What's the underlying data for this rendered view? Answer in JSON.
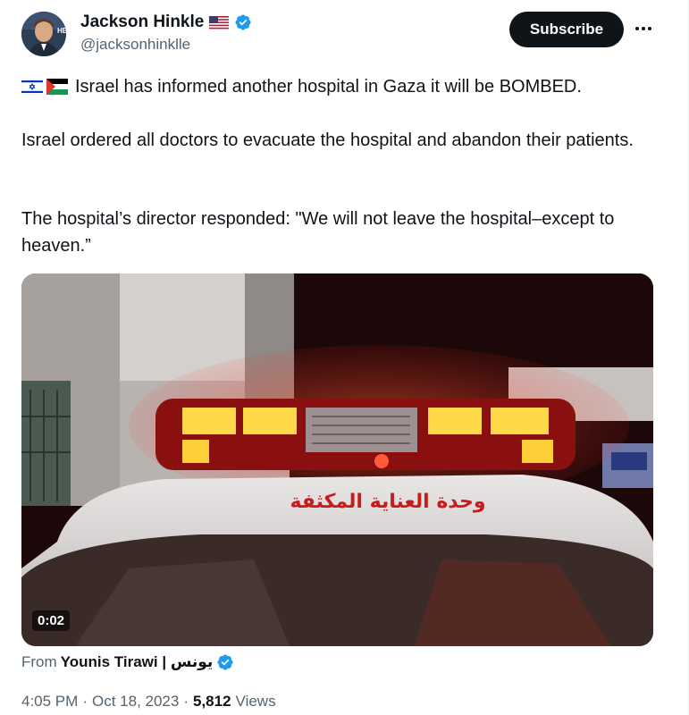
{
  "author": {
    "name": "Jackson Hinkle",
    "handle": "@jacksonhinklle",
    "verified_color": "#1d9bf0"
  },
  "actions": {
    "subscribe_label": "Subscribe",
    "more_icon": "more-horizontal-icon"
  },
  "tweet": {
    "line1": "Israel has informed another hospital in Gaza it will be BOMBED.",
    "line2": "Israel ordered all doctors to evacuate the hospital and abandon their patients.",
    "line3": "The hospital’s director responded: \"We will not leave the hospital–except to heaven.”",
    "flags": [
      "israel-flag-icon",
      "palestine-flag-icon"
    ]
  },
  "media": {
    "duration": "0:02",
    "arabic_sign": "وحدة العناية المكثفة"
  },
  "source": {
    "prefix": "From",
    "name": "Younis Tirawi | يونس"
  },
  "meta": {
    "time": "4:05 PM",
    "date": "Oct 18, 2023",
    "views_count": "5,812",
    "views_label": "Views",
    "separator": "·"
  }
}
